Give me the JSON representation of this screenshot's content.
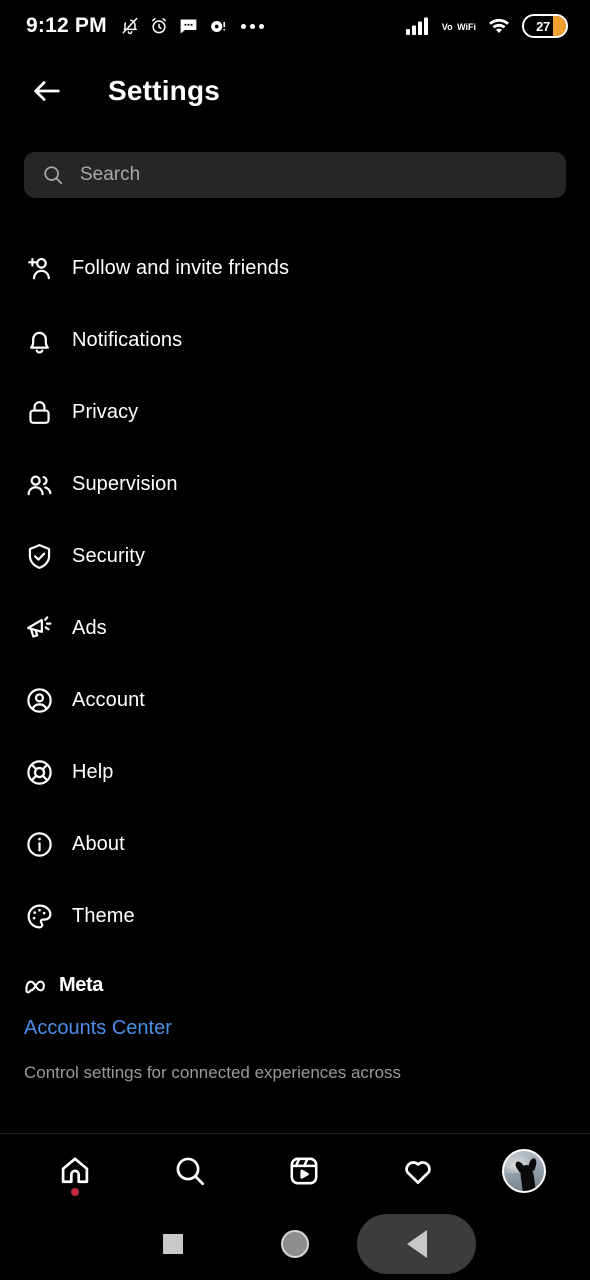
{
  "status_bar": {
    "time": "9:12 PM",
    "left_icons": [
      "silent-bell-icon",
      "alarm-clock-icon",
      "message-icon",
      "record-icon",
      "more-dots-icon"
    ],
    "network_label": "Vo",
    "network_sublabel": "WiFi",
    "right_icons": [
      "cellular-signal-icon",
      "volte-wifi-icon",
      "wifi-icon"
    ],
    "battery_percent": "27",
    "battery_color": "#f0a030"
  },
  "header": {
    "back_icon": "back-arrow-icon",
    "title": "Settings"
  },
  "search": {
    "icon": "search-icon",
    "placeholder": "Search",
    "value": "",
    "background": "#262626"
  },
  "menu": {
    "items": [
      {
        "label": "Follow and invite friends",
        "icon": "person-add-icon"
      },
      {
        "label": "Notifications",
        "icon": "bell-icon"
      },
      {
        "label": "Privacy",
        "icon": "lock-icon"
      },
      {
        "label": "Supervision",
        "icon": "people-icon"
      },
      {
        "label": "Security",
        "icon": "shield-check-icon"
      },
      {
        "label": "Ads",
        "icon": "megaphone-icon"
      },
      {
        "label": "Account",
        "icon": "account-circle-icon"
      },
      {
        "label": "Help",
        "icon": "life-ring-icon"
      },
      {
        "label": "About",
        "icon": "info-circle-icon"
      },
      {
        "label": "Theme",
        "icon": "palette-icon"
      }
    ]
  },
  "meta_section": {
    "logo_icon": "meta-infinity-icon",
    "brand": "Meta",
    "link_label": "Accounts Center",
    "link_color": "#4a8fe7",
    "description": "Control settings for connected experiences across"
  },
  "bottom_nav": {
    "items": [
      {
        "name": "home",
        "icon": "home-icon",
        "badge": true
      },
      {
        "name": "search",
        "icon": "search-icon",
        "badge": false
      },
      {
        "name": "reels",
        "icon": "reels-icon",
        "badge": false
      },
      {
        "name": "activity",
        "icon": "heart-icon",
        "badge": false
      },
      {
        "name": "profile",
        "icon": "avatar-icon",
        "badge": false
      }
    ],
    "badge_color": "#c2293a"
  },
  "android_nav": {
    "recents_icon": "square-recents-icon",
    "home_icon": "circle-home-icon",
    "back_icon": "triangle-back-icon"
  }
}
